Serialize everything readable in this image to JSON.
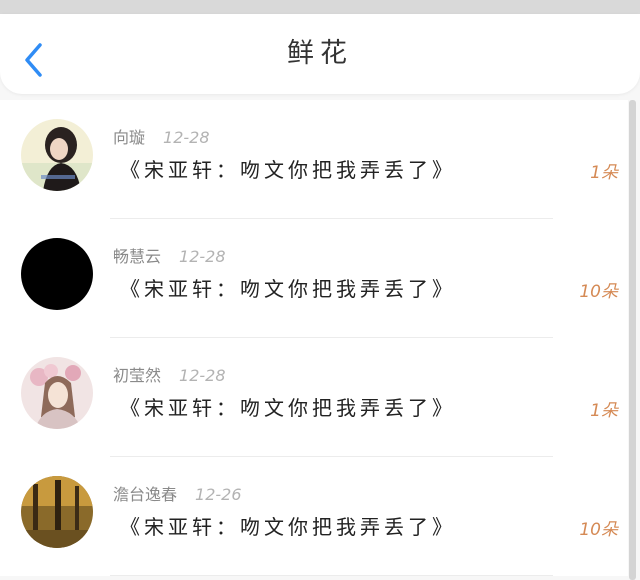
{
  "header": {
    "title": "鲜花",
    "back_icon": "chevron-left-icon"
  },
  "colors": {
    "accent": "#2f8cf5",
    "count": "#d58a55",
    "divider": "#ececec"
  },
  "items": [
    {
      "name": "向璇",
      "date": "12-28",
      "message": "《宋亚轩：吻文你把我弄丢了》",
      "count": "1朵"
    },
    {
      "name": "畅慧云",
      "date": "12-28",
      "message": "《宋亚轩：吻文你把我弄丢了》",
      "count": "10朵"
    },
    {
      "name": "初莹然",
      "date": "12-28",
      "message": "《宋亚轩：吻文你把我弄丢了》",
      "count": "1朵"
    },
    {
      "name": "澹台逸春",
      "date": "12-26",
      "message": "《宋亚轩：吻文你把我弄丢了》",
      "count": "10朵"
    }
  ]
}
